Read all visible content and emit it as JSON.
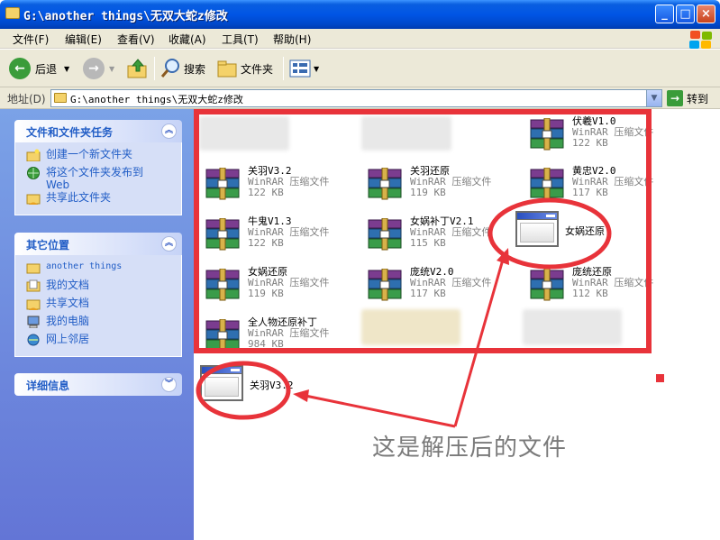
{
  "window": {
    "title": "G:\\another things\\无双大蛇z修改",
    "minimize": "_",
    "maximize": "□",
    "close": "×"
  },
  "menu": [
    "文件(F)",
    "编辑(E)",
    "查看(V)",
    "收藏(A)",
    "工具(T)",
    "帮助(H)"
  ],
  "toolbar": {
    "back_label": "后退",
    "search_label": "搜索",
    "folders_label": "文件夹"
  },
  "address": {
    "label": "地址(D)",
    "path": "G:\\another things\\无双大蛇z修改",
    "go_label": "转到"
  },
  "taskpane": {
    "file_tasks": {
      "title": "文件和文件夹任务",
      "items": [
        "创建一个新文件夹",
        "将这个文件夹发布到",
        "Web",
        "共享此文件夹"
      ]
    },
    "other_places": {
      "title": "其它位置",
      "items": [
        "another things",
        "我的文档",
        "共享文档",
        "我的电脑",
        "网上邻居"
      ]
    },
    "details": {
      "title": "详细信息"
    }
  },
  "files": [
    {
      "name": "伏羲V1.0",
      "type": "WinRAR 压缩文件",
      "size": "122 KB"
    },
    {
      "name": "关羽V3.2",
      "type": "WinRAR 压缩文件",
      "size": "122 KB"
    },
    {
      "name": "关羽还原",
      "type": "WinRAR 压缩文件",
      "size": "119 KB"
    },
    {
      "name": "黄忠V2.0",
      "type": "WinRAR 压缩文件",
      "size": "117 KB"
    },
    {
      "name": "牛鬼V1.3",
      "type": "WinRAR 压缩文件",
      "size": "122 KB"
    },
    {
      "name": "女娲补丁V2.1",
      "type": "WinRAR 压缩文件",
      "size": "115 KB"
    },
    {
      "name": "女娲还原",
      "type": "",
      "size": ""
    },
    {
      "name": "女娲还原",
      "type": "WinRAR 压缩文件",
      "size": "119 KB"
    },
    {
      "name": "庞统V2.0",
      "type": "WinRAR 压缩文件",
      "size": "117 KB"
    },
    {
      "name": "庞统还原",
      "type": "WinRAR 压缩文件",
      "size": "112 KB"
    },
    {
      "name": "全人物还原补丁",
      "type": "WinRAR 压缩文件",
      "size": "984 KB"
    },
    {
      "name": "关羽V3.2",
      "type": "",
      "size": ""
    }
  ],
  "annotation": {
    "callout_text": "这是解压后的文件",
    "color": "#e8333a"
  },
  "colors": {
    "titlebar": "#0055e5",
    "taskpane": "#6f8fe0",
    "link": "#215dc6",
    "highlight": "#e8333a"
  }
}
